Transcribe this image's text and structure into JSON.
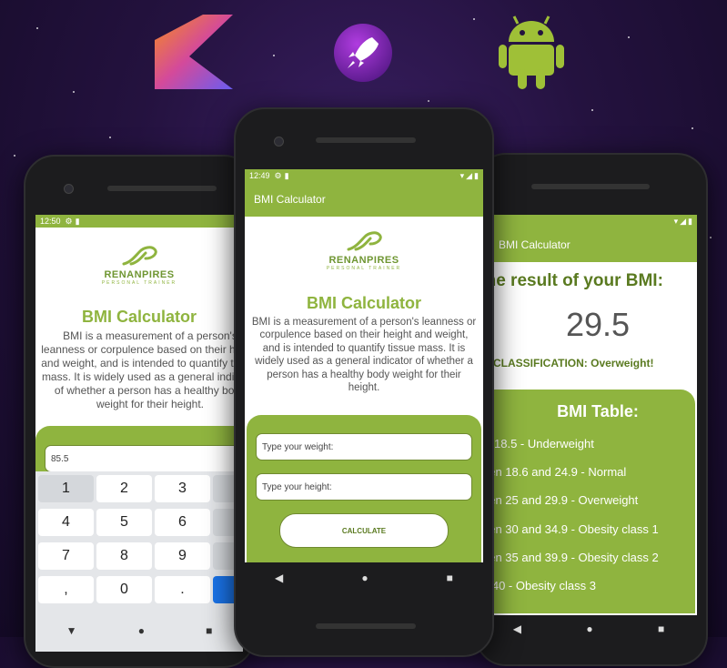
{
  "app_bar_title": "BMI Calculator",
  "logo": {
    "name": "RENANPIRES",
    "subtitle": "PERSONAL TRAINER"
  },
  "main_title": "BMI Calculator",
  "description": "BMI is a measurement of a person's leanness or corpulence based on their height and weight, and is intended to quantify tissue mass. It is widely used as a general indicator of whether a person has a healthy body weight for their height.",
  "left_phone": {
    "status_time": "12:50",
    "weight_value": "85.5",
    "keys": [
      "1",
      "2",
      "3",
      "4",
      "5",
      "6",
      "7",
      "8",
      "9",
      ",",
      "0",
      "."
    ]
  },
  "center_phone": {
    "status_time": "12:49",
    "weight_placeholder": "Type your weight:",
    "height_placeholder": "Type your height:",
    "calculate_label": "CALCULATE"
  },
  "right_phone": {
    "result_heading": "The result of your BMI:",
    "result_value": "29.5",
    "classification": "CLASSIFICATION: Overweight!",
    "table_title": "BMI Table:",
    "table_rows": [
      "w 18.5 - Underweight",
      "een 18.6 and 24.9 - Normal",
      "een 25 and 29.9 - Overweight",
      "een 30 and 34.9 - Obesity class 1",
      "een 35 and 39.9 - Obesity class 2",
      "e 40 - Obesity class 3"
    ]
  },
  "nav_icons": [
    "back-icon",
    "home-icon",
    "recents-icon"
  ],
  "colors": {
    "accent": "#8fb43f",
    "accent_dark": "#6f9632",
    "background": "#24123f"
  }
}
